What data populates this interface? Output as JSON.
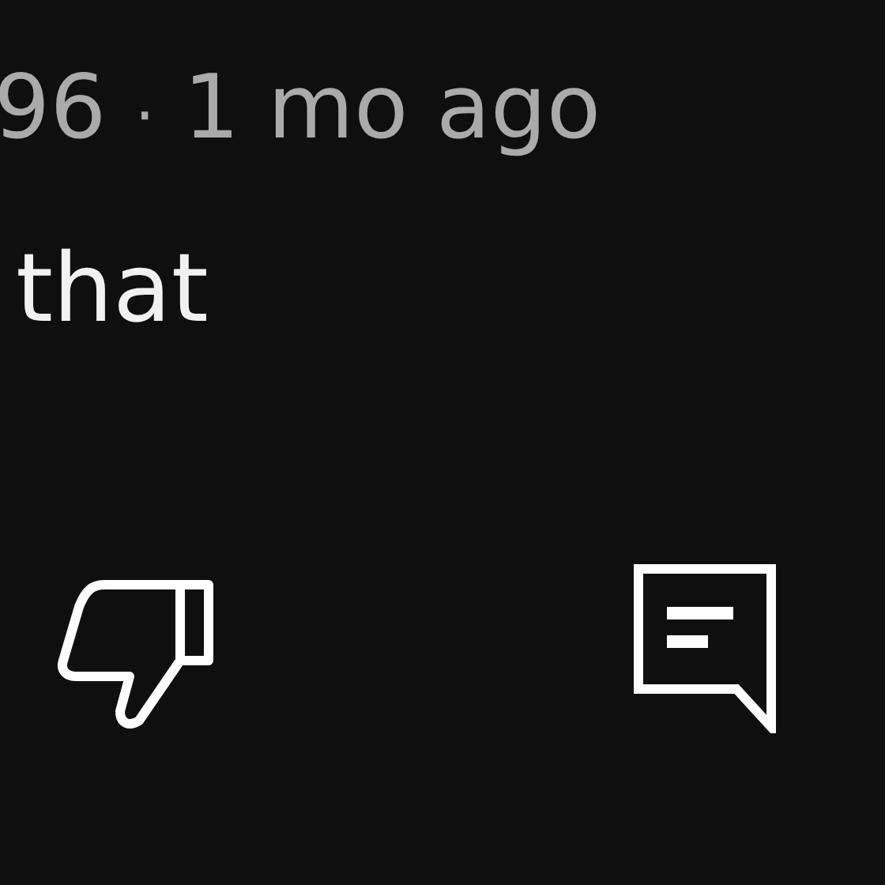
{
  "comment": {
    "author": "96",
    "separator": "·",
    "time": "1 mo ago",
    "text": "that"
  },
  "actions": [
    {
      "kind": "dislike"
    },
    {
      "kind": "reply"
    }
  ]
}
